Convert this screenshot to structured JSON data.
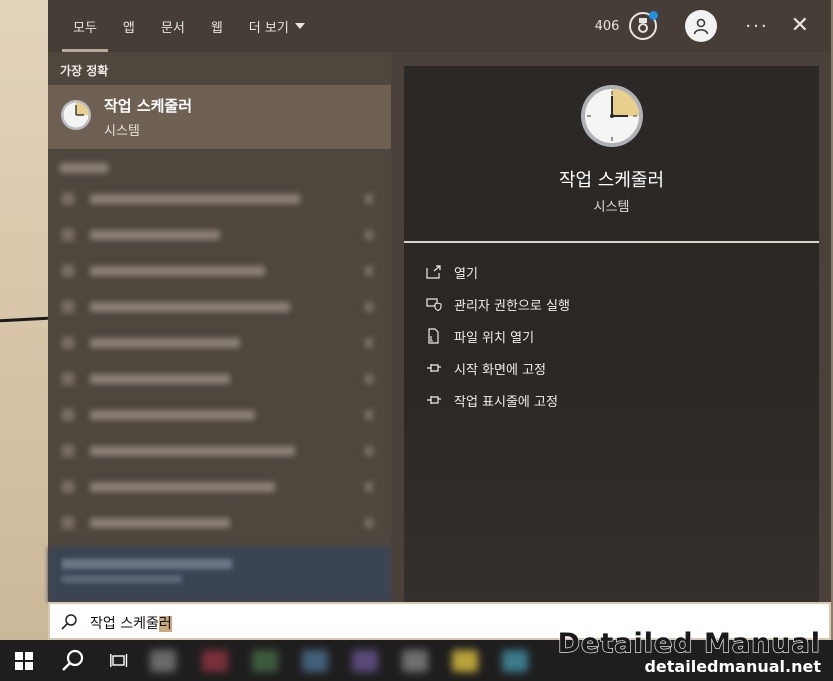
{
  "tabs": [
    {
      "label": "모두",
      "active": true
    },
    {
      "label": "앱",
      "active": false
    },
    {
      "label": "문서",
      "active": false
    },
    {
      "label": "웹",
      "active": false
    },
    {
      "label": "더 보기",
      "active": false
    }
  ],
  "header": {
    "points": "406",
    "icons": [
      "medal-icon",
      "account-icon",
      "ellipsis-icon",
      "close-icon"
    ]
  },
  "best_match": {
    "section_label": "가장 정확",
    "title": "작업 스케줄러",
    "subtitle": "시스템",
    "icon": "clock-icon"
  },
  "detail": {
    "title": "작업 스케줄러",
    "subtitle": "시스템",
    "actions": [
      {
        "label": "열기",
        "icon": "open-icon"
      },
      {
        "label": "관리자 권한으로 실행",
        "icon": "shield-icon"
      },
      {
        "label": "파일 위치 열기",
        "icon": "file-location-icon"
      },
      {
        "label": "시작 화면에 고정",
        "icon": "pin-icon"
      },
      {
        "label": "작업 표시줄에 고정",
        "icon": "pin-icon"
      }
    ]
  },
  "search": {
    "query_main": "작업 스케줄",
    "query_selected": "러"
  },
  "watermark": {
    "title": "Detailed Manual",
    "url": "detailedmanual.net"
  },
  "colors": {
    "accent_blue": "#1e8fe3",
    "selected_bg": "#6e6053",
    "panel_bg": "#2c2825"
  }
}
